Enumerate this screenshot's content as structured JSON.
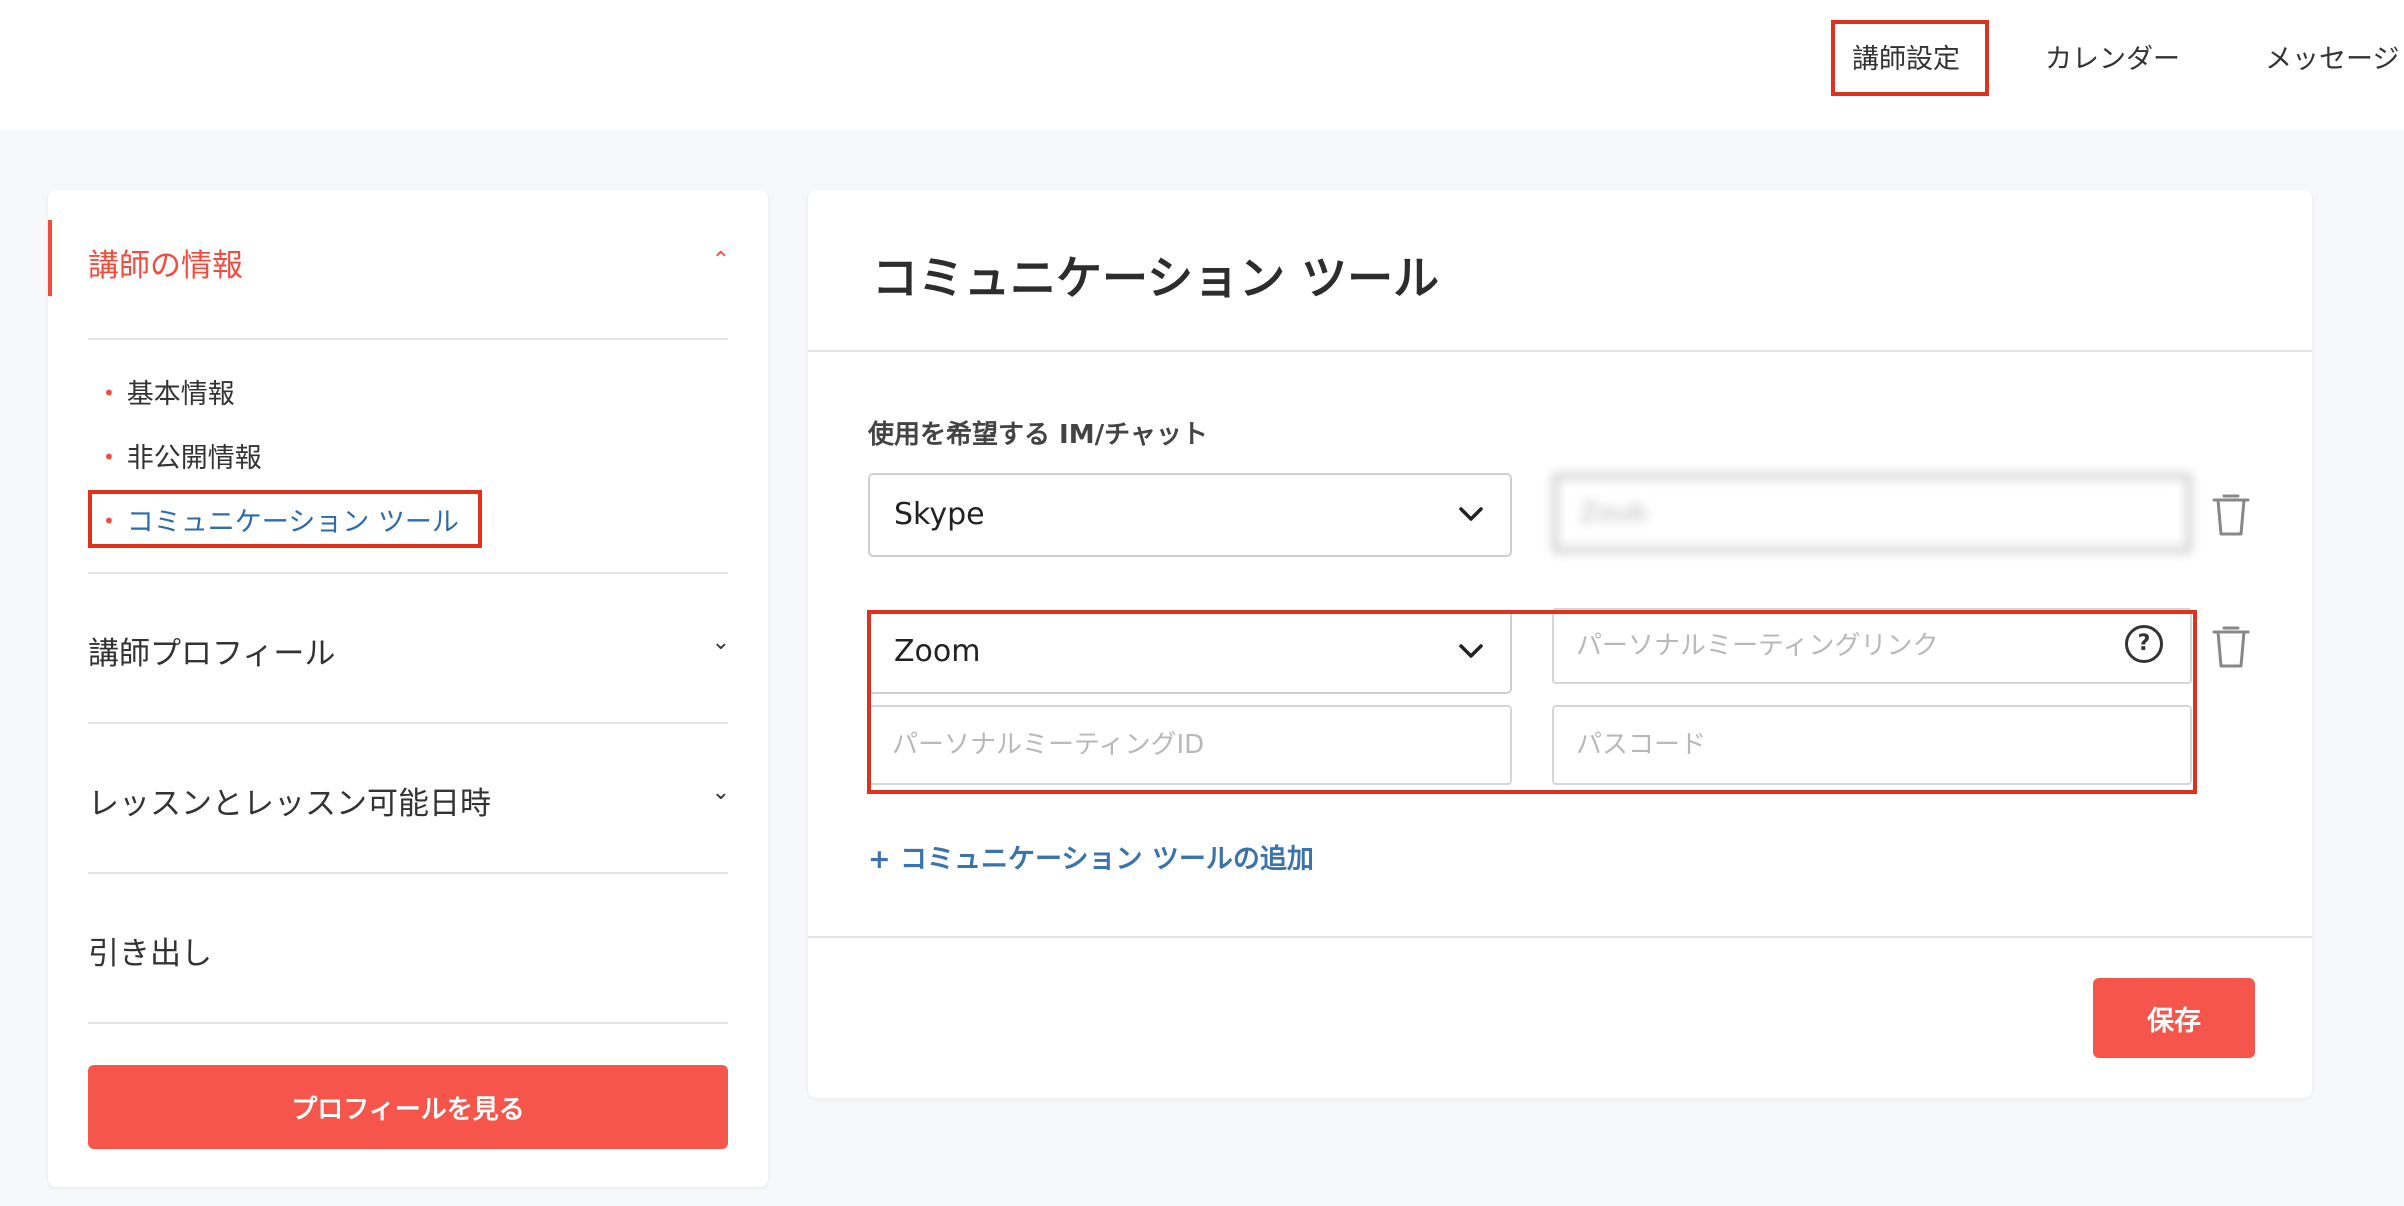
{
  "nav": {
    "items": [
      "講師設定",
      "カレンダー",
      "メッセージ"
    ]
  },
  "sidebar": {
    "section1": {
      "title": "講師の情報",
      "subitems": [
        "基本情報",
        "非公開情報",
        "コミュニケーション ツール"
      ]
    },
    "section2_title": "講師プロフィール",
    "section3_title": "レッスンとレッスン可能日時",
    "section4_title": "引き出し",
    "profile_button": "プロフィールを見る"
  },
  "main": {
    "title": "コミュニケーション ツール",
    "field_label": "使用を希望する IM/チャット",
    "rows": [
      {
        "tool": "Skype",
        "id_value": "Zoub"
      },
      {
        "tool": "Zoom",
        "link_placeholder": "パーソナルミーティングリンク",
        "meeting_id_placeholder": "パーソナルミーティングID",
        "passcode_placeholder": "パスコード"
      }
    ],
    "help_symbol": "?",
    "add_link": "+ コミュニケーション ツールの追加",
    "save_button": "保存"
  },
  "colors": {
    "accent": "#f44b3f",
    "button": "#f6554b",
    "link": "#3b73ad",
    "highlight_box": "#e0301e"
  }
}
